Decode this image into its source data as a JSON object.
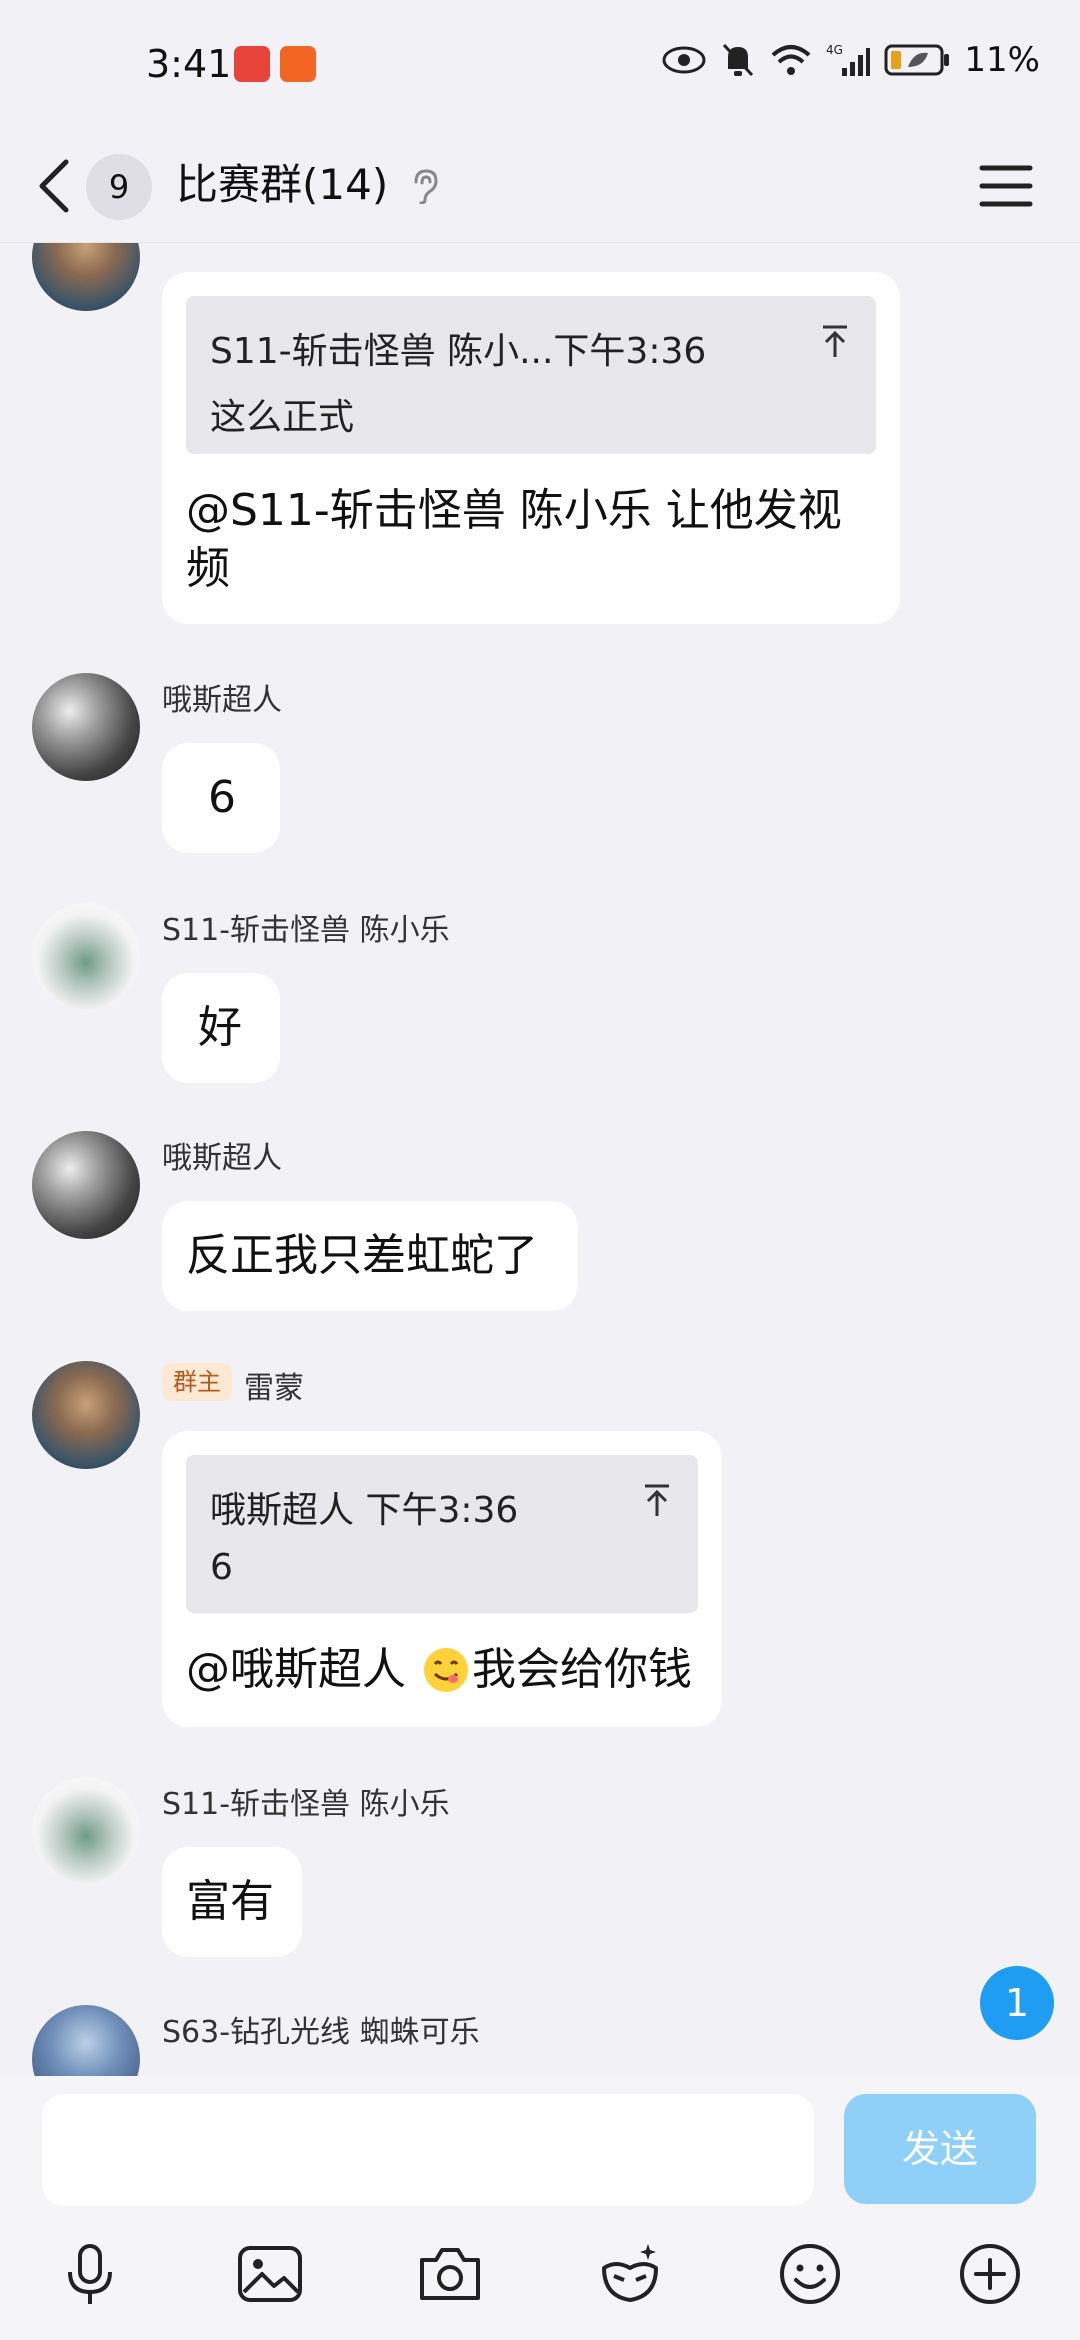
{
  "status_bar": {
    "time": "3:41",
    "battery": "11%"
  },
  "header": {
    "unread_count": "9",
    "title": "比赛群(14)"
  },
  "messages": {
    "m0": {
      "quote_sender_time": "S11-斩击怪兽   陈小...下午3:36",
      "quote_text": "这么正式",
      "text_line1": "@S11-斩击怪兽   陈小乐 让他发视",
      "text_line2": "频"
    },
    "m1": {
      "sender": "哦斯超人",
      "text": "6"
    },
    "m2": {
      "sender": "S11-斩击怪兽   陈小乐",
      "text": "好"
    },
    "m3": {
      "sender": "哦斯超人",
      "text": "反正我只差虹蛇了"
    },
    "m4": {
      "badge": "群主",
      "sender": "雷蒙",
      "quote_sender_time": "哦斯超人 下午3:36",
      "quote_text": "6",
      "text_prefix": "@哦斯超人 ",
      "text_suffix": "我会给你钱"
    },
    "m5": {
      "sender": "S11-斩击怪兽   陈小乐",
      "text": "富有"
    },
    "m6": {
      "sender": "S63-钻孔光线 蜘蛛可乐"
    }
  },
  "new_message_count": "1",
  "input": {
    "send_label": "发送"
  },
  "toolbar": [
    "mic-icon",
    "image-icon",
    "camera-icon",
    "sticker-icon",
    "emoji-icon",
    "plus-icon"
  ],
  "colors": {
    "send_button": "#8fd0f9",
    "badge_blue": "#1e9df2",
    "owner_badge_bg": "#fde9d3"
  }
}
